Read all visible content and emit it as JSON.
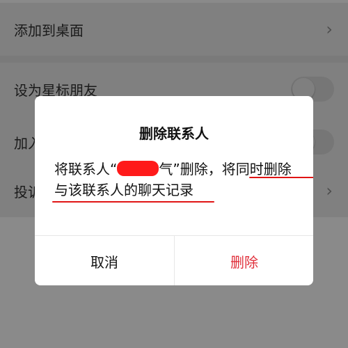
{
  "settings": {
    "rows": [
      {
        "label": "添加到桌面",
        "control": "chevron"
      },
      {
        "label": "设为星标朋友",
        "control": "toggle"
      },
      {
        "label": "加入黑名单",
        "control": "toggle",
        "visible_text": "加入"
      },
      {
        "label": "投诉",
        "control": "chevron",
        "visible_text": "投诉"
      }
    ]
  },
  "dialog": {
    "title": "删除联系人",
    "message_line1_prefix": "将联系人“",
    "message_line1_visible": "气",
    "message_line1_suffix": "”删除，",
    "message_line1_emphasis": "将同时删除",
    "message_line2": "与该联系人的聊天记录",
    "cancel_label": "取消",
    "delete_label": "删除"
  },
  "colors": {
    "overlay": "#8a8a8a",
    "dialog_bg": "#ffffff",
    "delete_text": "#e0303b",
    "underline": "#e01414",
    "redaction": "#ff1a1a"
  }
}
